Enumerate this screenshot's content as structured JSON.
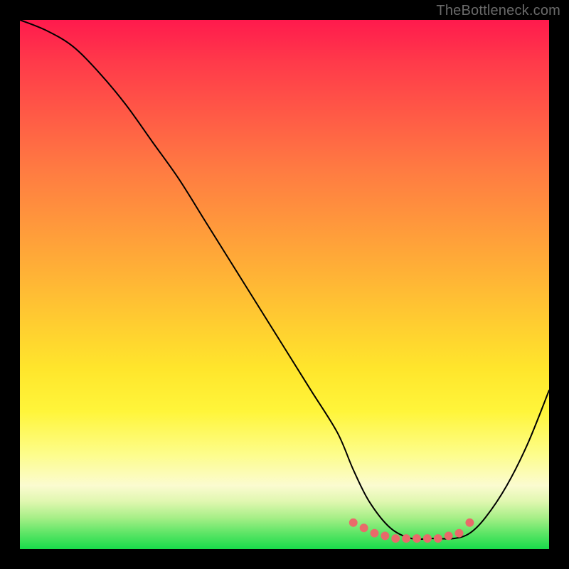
{
  "watermark": "TheBottleneck.com",
  "chart_data": {
    "type": "line",
    "title": "",
    "xlabel": "",
    "ylabel": "",
    "xlim": [
      0,
      100
    ],
    "ylim": [
      0,
      100
    ],
    "grid": false,
    "legend": false,
    "background_gradient": {
      "direction": "vertical",
      "stops": [
        {
          "pos": 0,
          "color": "#ff1a4d"
        },
        {
          "pos": 50,
          "color": "#ffb236"
        },
        {
          "pos": 75,
          "color": "#fff53a"
        },
        {
          "pos": 90,
          "color": "#fbfbd0"
        },
        {
          "pos": 100,
          "color": "#18db4a"
        }
      ]
    },
    "series": [
      {
        "name": "bottleneck-curve",
        "color": "#000000",
        "x": [
          0,
          5,
          10,
          15,
          20,
          25,
          30,
          35,
          40,
          45,
          50,
          55,
          60,
          63,
          66,
          70,
          74,
          78,
          82,
          85,
          88,
          92,
          96,
          100
        ],
        "values": [
          100,
          98,
          95,
          90,
          84,
          77,
          70,
          62,
          54,
          46,
          38,
          30,
          22,
          15,
          9,
          4,
          2,
          2,
          2,
          3,
          6,
          12,
          20,
          30
        ]
      }
    ],
    "dotted_region": {
      "name": "optimal-range-dots",
      "color": "#e96a6a",
      "x": [
        63,
        65,
        67,
        69,
        71,
        73,
        75,
        77,
        79,
        81,
        83,
        85
      ],
      "values": [
        5,
        4,
        3,
        2.5,
        2,
        2,
        2,
        2,
        2,
        2.5,
        3,
        5
      ]
    }
  }
}
